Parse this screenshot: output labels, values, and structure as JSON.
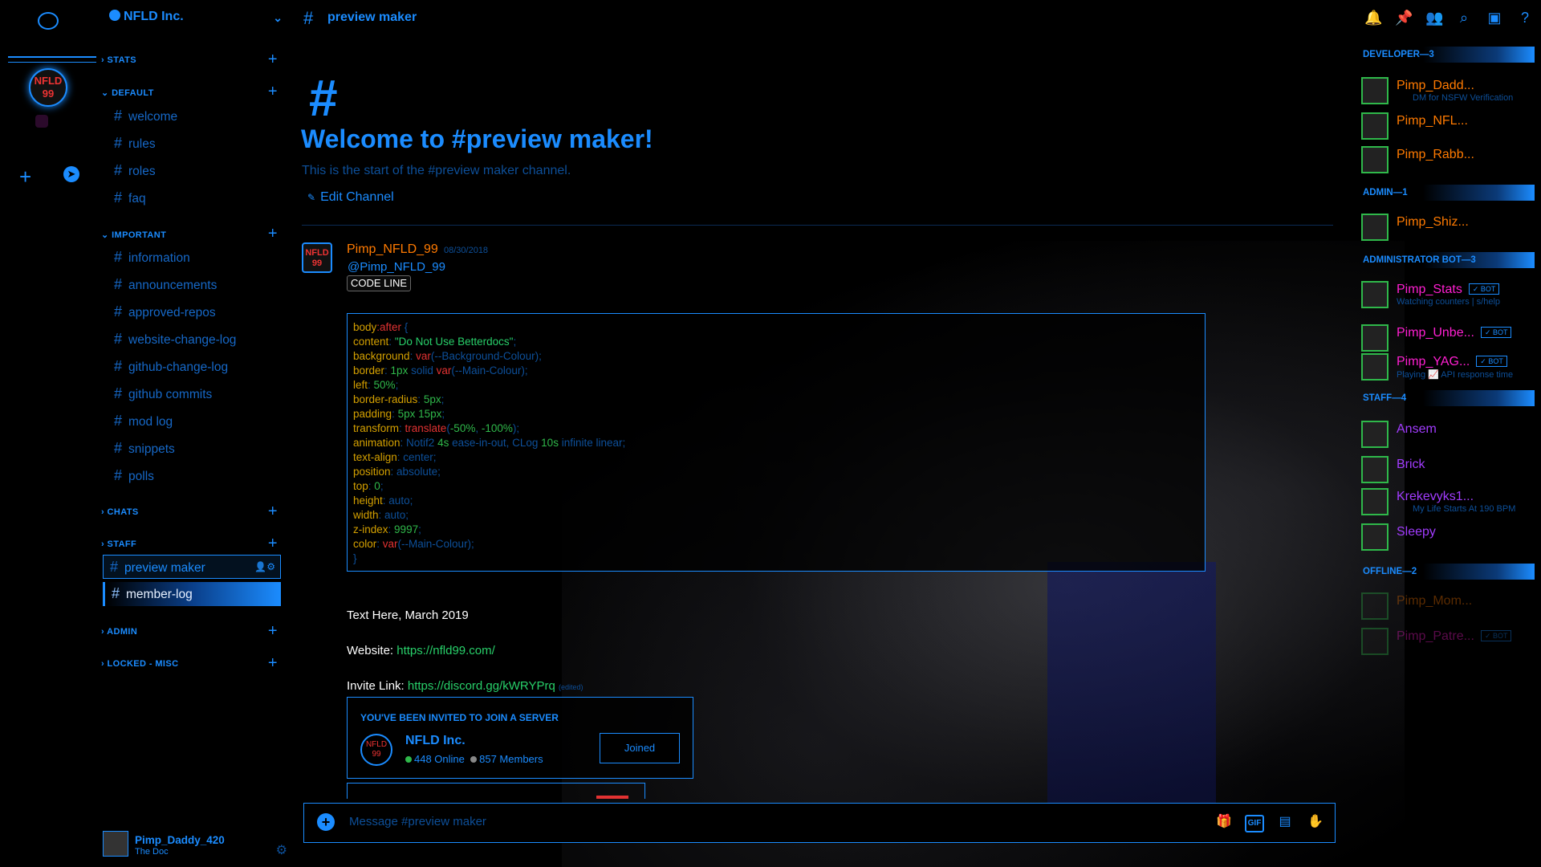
{
  "server": {
    "name": "NFLD Inc.",
    "icon_text": "NFLD 99"
  },
  "categories": [
    {
      "label": "STATS"
    },
    {
      "label": "DEFAULT"
    },
    {
      "label": "IMPORTANT"
    },
    {
      "label": "CHATS"
    },
    {
      "label": "STAFF"
    },
    {
      "label": "ADMIN"
    },
    {
      "label": "LOCKED - MISC"
    }
  ],
  "channels": {
    "default": [
      "welcome",
      "rules",
      "roles",
      "faq"
    ],
    "important": [
      "information",
      "announcements",
      "approved-repos",
      "website-change-log",
      "github-change-log",
      "github commits",
      "mod log",
      "snippets",
      "polls"
    ],
    "staff": [
      "preview maker",
      "member-log"
    ]
  },
  "user": {
    "name": "Pimp_Daddy_420",
    "status": "The Doc"
  },
  "header": {
    "channel": "preview maker"
  },
  "welcome": {
    "title": "Welcome to #preview maker!",
    "subtitle": "This is the start of the #preview maker channel.",
    "edit": "Edit Channel"
  },
  "message": {
    "author": "Pimp_NFLD_99",
    "date": "08/30/2018",
    "mention": "@Pimp_NFLD_99",
    "code_label": "CODE LINE",
    "code": [
      [
        [
          "k",
          "body"
        ],
        [
          "f",
          ":after"
        ],
        [
          "d",
          " {"
        ]
      ],
      [
        [
          "k",
          "content"
        ],
        [
          "d",
          ": "
        ],
        [
          "s",
          "\"Do Not Use Betterdocs\""
        ],
        [
          "d",
          ";"
        ]
      ],
      [
        [
          "k",
          "background"
        ],
        [
          "d",
          ": "
        ],
        [
          "f",
          "var"
        ],
        [
          "d",
          "(--Background-Colour);"
        ]
      ],
      [
        [
          "k",
          "border"
        ],
        [
          "d",
          ": "
        ],
        [
          "v",
          "1px"
        ],
        [
          "d",
          " solid "
        ],
        [
          "f",
          "var"
        ],
        [
          "d",
          "(--Main-Colour);"
        ]
      ],
      [
        [
          "k",
          "left"
        ],
        [
          "d",
          ": "
        ],
        [
          "v",
          "50%"
        ],
        [
          "d",
          ";"
        ]
      ],
      [
        [
          "k",
          "border-radius"
        ],
        [
          "d",
          ": "
        ],
        [
          "v",
          "5px"
        ],
        [
          "d",
          ";"
        ]
      ],
      [
        [
          "k",
          "padding"
        ],
        [
          "d",
          ": "
        ],
        [
          "v",
          "5px 15px"
        ],
        [
          "d",
          ";"
        ]
      ],
      [
        [
          "k",
          "transform"
        ],
        [
          "d",
          ": "
        ],
        [
          "f",
          "translate"
        ],
        [
          "d",
          "("
        ],
        [
          "v",
          "-50%"
        ],
        [
          "d",
          ", "
        ],
        [
          "v",
          "-100%"
        ],
        [
          "d",
          ");"
        ]
      ],
      [
        [
          "k",
          "animation"
        ],
        [
          "d",
          ": Notif2 "
        ],
        [
          "v",
          "4s"
        ],
        [
          "d",
          " ease-in-out, CLog "
        ],
        [
          "v",
          "10s"
        ],
        [
          "d",
          " infinite linear;"
        ]
      ],
      [
        [
          "k",
          "text-align"
        ],
        [
          "d",
          ": center;"
        ]
      ],
      [
        [
          "k",
          "position"
        ],
        [
          "d",
          ": absolute;"
        ]
      ],
      [
        [
          "k",
          "top"
        ],
        [
          "d",
          ": "
        ],
        [
          "v",
          "0"
        ],
        [
          "d",
          ";"
        ]
      ],
      [
        [
          "k",
          "height"
        ],
        [
          "d",
          ": auto;"
        ]
      ],
      [
        [
          "k",
          "width"
        ],
        [
          "d",
          ": auto;"
        ]
      ],
      [
        [
          "k",
          "z-index"
        ],
        [
          "d",
          ": "
        ],
        [
          "v",
          "9997"
        ],
        [
          "d",
          ";"
        ]
      ],
      [
        [
          "k",
          "color"
        ],
        [
          "d",
          ": "
        ],
        [
          "f",
          "var"
        ],
        [
          "d",
          "(--Main-Colour);"
        ]
      ],
      [
        [
          "d",
          "}"
        ]
      ]
    ],
    "line1": "Text Here, March 2019",
    "website_label": "Website: ",
    "website_url": "https://nfld99.com/",
    "invite_label": "Invite Link: ",
    "invite_url": "https://discord.gg/kWRYPrq",
    "edited": "(edited)"
  },
  "invite": {
    "header": "YOU'VE BEEN INVITED TO JOIN A SERVER",
    "name": "NFLD Inc.",
    "online": "448 Online",
    "members": "857 Members",
    "button": "Joined"
  },
  "composer": {
    "placeholder": "Message #preview maker"
  },
  "member_groups": [
    {
      "label": "DEVELOPER—3",
      "members": [
        {
          "name": "Pimp_Dadd...",
          "status": "DM for NSFW Verification",
          "color": "#ff7a00"
        },
        {
          "name": "Pimp_NFL...",
          "status": "",
          "color": "#ff7a00"
        },
        {
          "name": "Pimp_Rabb...",
          "status": "",
          "color": "#ff7a00"
        }
      ]
    },
    {
      "label": "ADMIN—1",
      "members": [
        {
          "name": "Pimp_Shiz...",
          "status": "",
          "color": "#ff7a00"
        }
      ]
    },
    {
      "label": "ADMINISTRATOR BOT—3",
      "members": [
        {
          "name": "Pimp_Stats",
          "status": "Watching counters | s/help",
          "color": "#ff1fd1",
          "bot": "✓ BOT"
        },
        {
          "name": "Pimp_Unbe...",
          "status": "",
          "color": "#ff1fd1",
          "bot": "✓ BOT"
        },
        {
          "name": "Pimp_YAG...",
          "status": "Playing 📈 API response time",
          "color": "#ff1fd1",
          "bot": "✓ BOT"
        }
      ]
    },
    {
      "label": "STAFF—4",
      "members": [
        {
          "name": "Ansem",
          "status": "",
          "color": "#a23cff"
        },
        {
          "name": "Brick",
          "status": "",
          "color": "#a23cff"
        },
        {
          "name": "Krekevyks1...",
          "status": "My Life Starts At 190 BPM",
          "color": "#a23cff"
        },
        {
          "name": "Sleepy",
          "status": "",
          "color": "#a23cff"
        }
      ]
    },
    {
      "label": "OFFLINE—2",
      "members": [
        {
          "name": "Pimp_Mom...",
          "status": "",
          "color": "#ff7a00"
        },
        {
          "name": "Pimp_Patre...",
          "status": "",
          "color": "#ff1fd1",
          "bot": "✓ BOT"
        }
      ]
    }
  ]
}
